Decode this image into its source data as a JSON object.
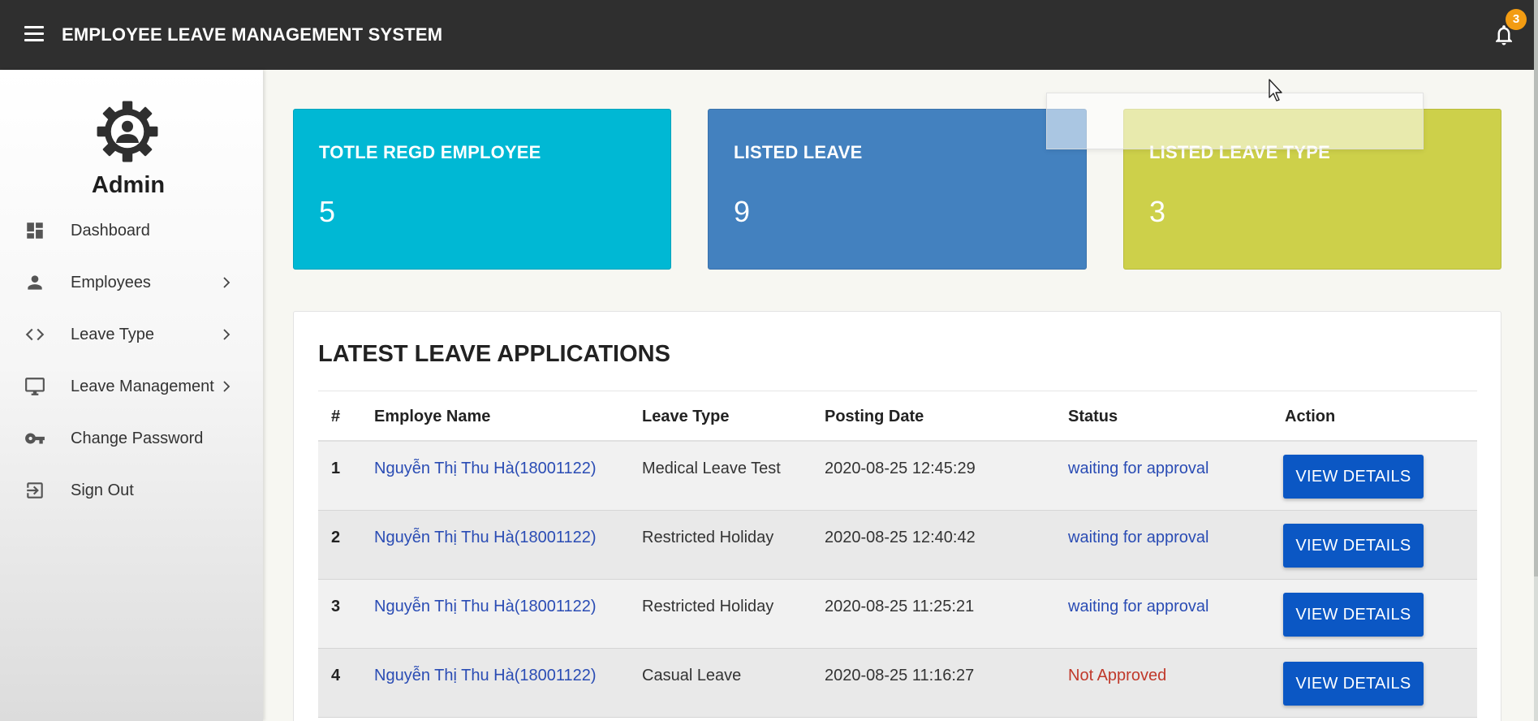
{
  "header": {
    "title": "EMPLOYEE LEAVE MANAGEMENT SYSTEM",
    "notification_count": "3"
  },
  "sidebar": {
    "user_name": "Admin",
    "items": [
      {
        "label": "Dashboard",
        "icon": "dashboard-icon",
        "has_submenu": false
      },
      {
        "label": "Employees",
        "icon": "person-icon",
        "has_submenu": true
      },
      {
        "label": "Leave Type",
        "icon": "code-icon",
        "has_submenu": true
      },
      {
        "label": "Leave Management",
        "icon": "monitor-icon",
        "has_submenu": true
      },
      {
        "label": "Change Password",
        "icon": "key-icon",
        "has_submenu": false
      },
      {
        "label": "Sign Out",
        "icon": "sign-out-icon",
        "has_submenu": false
      }
    ]
  },
  "stats": [
    {
      "title": "TOTLE REGD EMPLOYEE",
      "value": "5",
      "color": "#00b8d4"
    },
    {
      "title": "LISTED LEAVE",
      "value": "9",
      "color": "#4381bf"
    },
    {
      "title": "LISTED LEAVE TYPE",
      "value": "3",
      "color": "#cdd04a"
    }
  ],
  "applications": {
    "title": "LATEST LEAVE APPLICATIONS",
    "columns": [
      "#",
      "Employe Name",
      "Leave Type",
      "Posting Date",
      "Status",
      "Action"
    ],
    "rows": [
      {
        "num": "1",
        "name": "Nguyễn Thị Thu Hà(18001122)",
        "leave_type": "Medical Leave Test",
        "date": "2020-08-25 12:45:29",
        "status": "waiting for approval",
        "status_kind": "waiting",
        "action": "VIEW DETAILS"
      },
      {
        "num": "2",
        "name": "Nguyễn Thị Thu Hà(18001122)",
        "leave_type": "Restricted Holiday",
        "date": "2020-08-25 12:40:42",
        "status": "waiting for approval",
        "status_kind": "waiting",
        "action": "VIEW DETAILS"
      },
      {
        "num": "3",
        "name": "Nguyễn Thị Thu Hà(18001122)",
        "leave_type": "Restricted Holiday",
        "date": "2020-08-25 11:25:21",
        "status": "waiting for approval",
        "status_kind": "waiting",
        "action": "VIEW DETAILS"
      },
      {
        "num": "4",
        "name": "Nguyễn Thị Thu Hà(18001122)",
        "leave_type": "Casual Leave",
        "date": "2020-08-25 11:16:27",
        "status": "Not Approved",
        "status_kind": "rejected",
        "action": "VIEW DETAILS"
      }
    ]
  }
}
